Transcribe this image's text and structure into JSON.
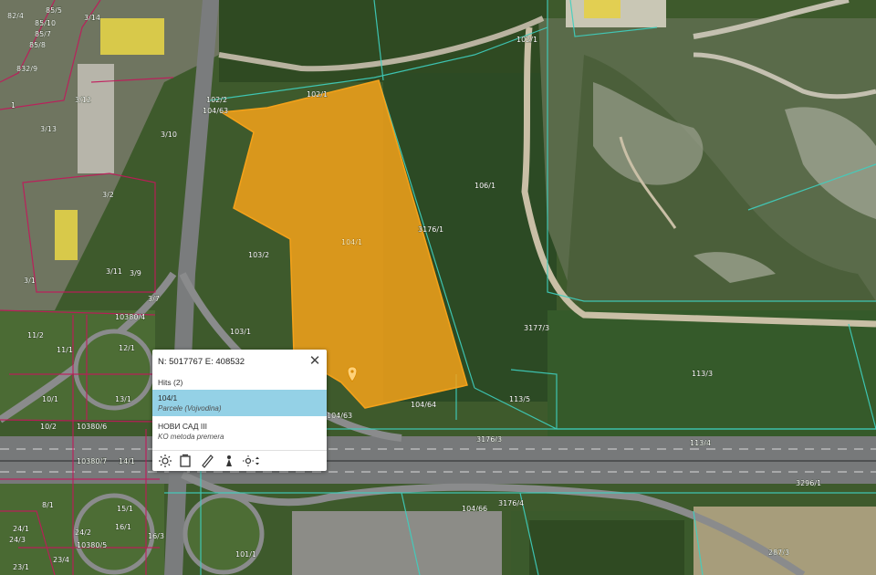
{
  "popup": {
    "coords": "N: 5017767 E: 408532",
    "close_glyph": "✕",
    "hits_label": "Hits (2)",
    "results": [
      {
        "title": "104/1",
        "subtitle": "Parcele (Vojvodina)"
      },
      {
        "title": "НОВИ САД III",
        "subtitle": "KO metoda premera"
      }
    ],
    "toolbar_icons": [
      "brightness-icon",
      "document-icon",
      "ruler-icon",
      "person-icon",
      "brightness-adjust-icon"
    ]
  },
  "map": {
    "selected_parcel": "104/1",
    "selected_fill": "#f5a21a",
    "parcel_line_color": "#3fd0c0",
    "cadastre_line_color": "#c2185b",
    "parcel_labels": [
      "85/5",
      "3/14",
      "85/10",
      "82/4",
      "85/7",
      "85/8",
      "832/9",
      "1",
      "3/12",
      "3/13",
      "3/10",
      "3/2",
      "3/11",
      "3/1",
      "3/9",
      "3/7",
      "102/1",
      "102/1",
      "102/2",
      "104/63",
      "104/1",
      "103/2",
      "106/1",
      "3176/1",
      "10380/4",
      "103/1",
      "12/1",
      "11/2",
      "11/1",
      "13/1",
      "10/1",
      "10/2",
      "10380/6",
      "10380/7",
      "14/1",
      "104/64",
      "104/63",
      "113/5",
      "3177/3",
      "113/3",
      "3176/3",
      "113/4",
      "3296/1",
      "3176/4",
      "104/66",
      "8/1",
      "15/1",
      "16/1",
      "16/3",
      "24/1",
      "24/2",
      "10380/5",
      "24/3",
      "23/4",
      "23/1",
      "101/1",
      "287/3"
    ]
  }
}
